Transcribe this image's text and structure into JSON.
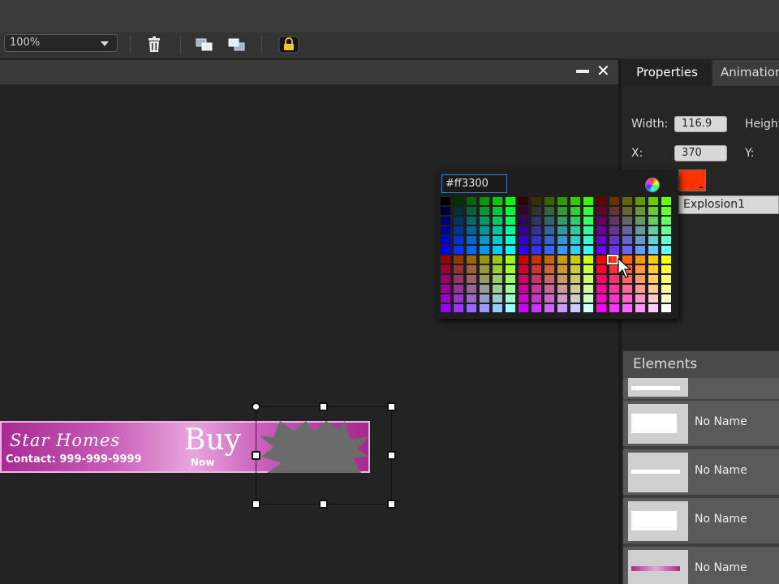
{
  "toolbar": {
    "zoom_value": "100%",
    "buttons": [
      "trash-icon",
      "bring-forward-icon",
      "send-backward-icon",
      "lock-icon"
    ]
  },
  "stage_window": {
    "minimize_icon": "minimize-icon",
    "close_symbol": "✕"
  },
  "panel": {
    "tabs": [
      {
        "label": "Properties"
      },
      {
        "label": "Animation"
      }
    ],
    "width_label": "Width:",
    "width_value": "116.9",
    "height_label": "Height:",
    "x_label": "X:",
    "x_value": "370",
    "y_label": "Y:",
    "element_name_value": "Explosion1"
  },
  "color_picker": {
    "hex_value": "#ff3300",
    "current_color": "#ff3300"
  },
  "elements": {
    "header": "Elements",
    "items": [
      {
        "name": "No Name"
      },
      {
        "name": "No Name"
      },
      {
        "name": "No Name"
      },
      {
        "name": "No Name"
      }
    ]
  },
  "banner": {
    "title": "Star Homes",
    "contact": "Contact: 999-999-9999",
    "buy": "Buy",
    "now": "Now"
  }
}
